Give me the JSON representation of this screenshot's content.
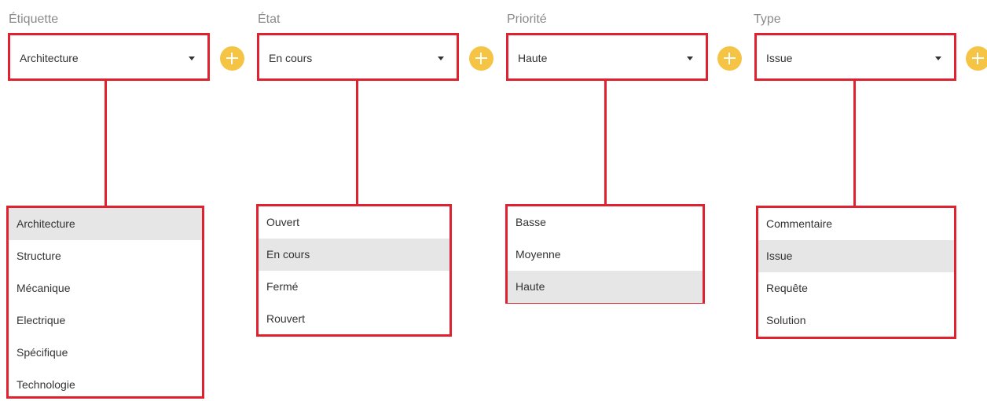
{
  "filters": [
    {
      "label": "Étiquette",
      "value": "Architecture",
      "options": [
        "Architecture",
        "Structure",
        "Mécanique",
        "Electrique",
        "Spécifique",
        "Technologie"
      ],
      "selected_index": 0
    },
    {
      "label": "État",
      "value": "En cours",
      "options": [
        "Ouvert",
        "En cours",
        "Fermé",
        "Rouvert"
      ],
      "selected_index": 1
    },
    {
      "label": "Priorité",
      "value": "Haute",
      "options": [
        "Basse",
        "Moyenne",
        "Haute"
      ],
      "selected_index": 2
    },
    {
      "label": "Type",
      "value": "Issue",
      "options": [
        "Commentaire",
        "Issue",
        "Requête",
        "Solution"
      ],
      "selected_index": 1
    }
  ],
  "icons": {
    "caret": "caret-down-icon",
    "add": "plus-icon"
  },
  "colors": {
    "highlight_border": "#e02230",
    "add_button": "#f6c444",
    "selected_option_bg": "#e6e6e6",
    "label_text": "#8a8a8a"
  }
}
